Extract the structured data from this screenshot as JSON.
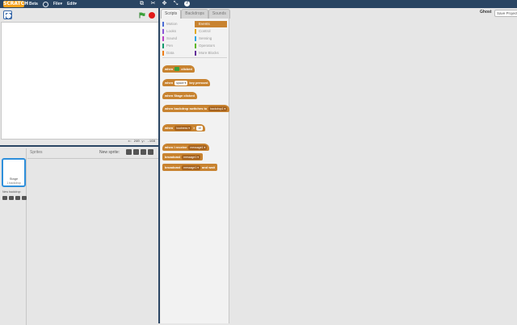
{
  "topbar": {
    "logo": "SCRATCH",
    "beta": "Beta",
    "file_menu": "File▾",
    "edit_menu": "Edit▾",
    "icons": [
      "stamp-icon",
      "cut-icon",
      "grow-icon",
      "shrink-icon",
      "help-icon"
    ]
  },
  "stage": {
    "coords": "x: 240   y: -168"
  },
  "sprite_pane": {
    "sprites_label": "Sprites",
    "new_sprite_label": "New sprite:",
    "stage_label": "Stage",
    "stage_sub": "1 backdrop",
    "new_backdrop_label": "New backdrop:"
  },
  "tabs": [
    "Scripts",
    "Backdrops",
    "Sounds"
  ],
  "categories": [
    {
      "label": "Motion",
      "color": "#4a6cd4"
    },
    {
      "label": "Events",
      "color": "#c88330",
      "selected": true
    },
    {
      "label": "Looks",
      "color": "#8a55d7"
    },
    {
      "label": "Control",
      "color": "#e1a91a"
    },
    {
      "label": "Sound",
      "color": "#bb42c3"
    },
    {
      "label": "Sensing",
      "color": "#2ca5e2"
    },
    {
      "label": "Pen",
      "color": "#0e9a6c"
    },
    {
      "label": "Operators",
      "color": "#5cb712"
    },
    {
      "label": "Data",
      "color": "#ee7d16"
    },
    {
      "label": "More Blocks",
      "color": "#632d99"
    }
  ],
  "blocks": {
    "when_flag": {
      "pre": "when",
      "post": "clicked"
    },
    "when_key": {
      "pre": "when",
      "slot": "space ▾",
      "post": "key pressed"
    },
    "when_stage": {
      "text": "when Stage clicked"
    },
    "when_backdrop": {
      "pre": "when backdrop switches to",
      "slot": "backdrop1 ▾"
    },
    "when_loudness": {
      "pre": "when",
      "slot": "loudness ▾",
      "op": ">",
      "value": "10"
    },
    "when_receive": {
      "pre": "when I receive",
      "slot": "message1 ▾"
    },
    "broadcast": {
      "pre": "broadcast",
      "slot": "message1 ▾"
    },
    "broadcast_wait": {
      "pre": "broadcast",
      "slot": "message1 ▾",
      "post": "and wait"
    }
  },
  "scripts_area": {
    "sprite_name": "Ghost",
    "save_project": "Save Project"
  }
}
